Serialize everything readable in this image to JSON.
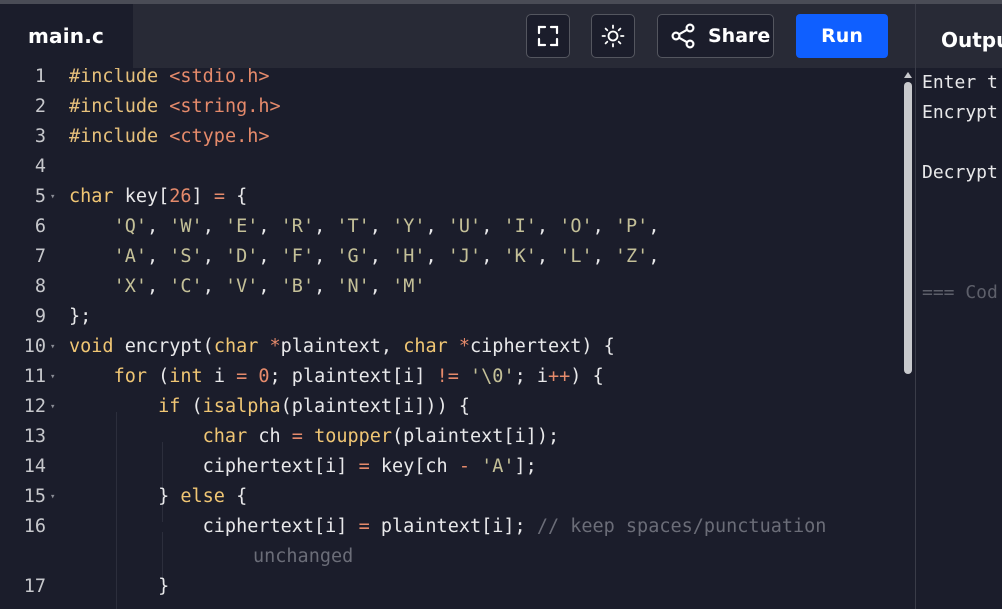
{
  "tab": {
    "title": "main.c"
  },
  "toolbar": {
    "fullscreen_icon": "fullscreen-icon",
    "theme_icon": "sun-icon",
    "share_icon": "share-icon",
    "share_label": "Share",
    "run_label": "Run",
    "run_color": "#0f5fff"
  },
  "output": {
    "title": "Output",
    "lines": [
      "Enter t",
      "Encrypt",
      "",
      "Decrypt",
      "",
      "",
      "",
      "=== Cod"
    ]
  },
  "editor": {
    "lines": [
      {
        "n": "1",
        "fold": false,
        "tokens": [
          [
            "pp",
            "#include "
          ],
          [
            "str",
            "<stdio.h>"
          ]
        ]
      },
      {
        "n": "2",
        "fold": false,
        "tokens": [
          [
            "pp",
            "#include "
          ],
          [
            "str",
            "<string.h>"
          ]
        ]
      },
      {
        "n": "3",
        "fold": false,
        "tokens": [
          [
            "pp",
            "#include "
          ],
          [
            "str",
            "<ctype.h>"
          ]
        ]
      },
      {
        "n": "4",
        "fold": false,
        "tokens": []
      },
      {
        "n": "5",
        "fold": true,
        "tokens": [
          [
            "kw",
            "char"
          ],
          [
            "txt",
            " key["
          ],
          [
            "num",
            "26"
          ],
          [
            "txt",
            "] "
          ],
          [
            "op",
            "="
          ],
          [
            "txt",
            " {"
          ]
        ]
      },
      {
        "n": "6",
        "fold": false,
        "tokens": [
          [
            "txt",
            "    "
          ],
          [
            "chr",
            "'Q'"
          ],
          [
            "txt",
            ", "
          ],
          [
            "chr",
            "'W'"
          ],
          [
            "txt",
            ", "
          ],
          [
            "chr",
            "'E'"
          ],
          [
            "txt",
            ", "
          ],
          [
            "chr",
            "'R'"
          ],
          [
            "txt",
            ", "
          ],
          [
            "chr",
            "'T'"
          ],
          [
            "txt",
            ", "
          ],
          [
            "chr",
            "'Y'"
          ],
          [
            "txt",
            ", "
          ],
          [
            "chr",
            "'U'"
          ],
          [
            "txt",
            ", "
          ],
          [
            "chr",
            "'I'"
          ],
          [
            "txt",
            ", "
          ],
          [
            "chr",
            "'O'"
          ],
          [
            "txt",
            ", "
          ],
          [
            "chr",
            "'P'"
          ],
          [
            "txt",
            ","
          ]
        ]
      },
      {
        "n": "7",
        "fold": false,
        "tokens": [
          [
            "txt",
            "    "
          ],
          [
            "chr",
            "'A'"
          ],
          [
            "txt",
            ", "
          ],
          [
            "chr",
            "'S'"
          ],
          [
            "txt",
            ", "
          ],
          [
            "chr",
            "'D'"
          ],
          [
            "txt",
            ", "
          ],
          [
            "chr",
            "'F'"
          ],
          [
            "txt",
            ", "
          ],
          [
            "chr",
            "'G'"
          ],
          [
            "txt",
            ", "
          ],
          [
            "chr",
            "'H'"
          ],
          [
            "txt",
            ", "
          ],
          [
            "chr",
            "'J'"
          ],
          [
            "txt",
            ", "
          ],
          [
            "chr",
            "'K'"
          ],
          [
            "txt",
            ", "
          ],
          [
            "chr",
            "'L'"
          ],
          [
            "txt",
            ", "
          ],
          [
            "chr",
            "'Z'"
          ],
          [
            "txt",
            ","
          ]
        ]
      },
      {
        "n": "8",
        "fold": false,
        "tokens": [
          [
            "txt",
            "    "
          ],
          [
            "chr",
            "'X'"
          ],
          [
            "txt",
            ", "
          ],
          [
            "chr",
            "'C'"
          ],
          [
            "txt",
            ", "
          ],
          [
            "chr",
            "'V'"
          ],
          [
            "txt",
            ", "
          ],
          [
            "chr",
            "'B'"
          ],
          [
            "txt",
            ", "
          ],
          [
            "chr",
            "'N'"
          ],
          [
            "txt",
            ", "
          ],
          [
            "chr",
            "'M'"
          ]
        ]
      },
      {
        "n": "9",
        "fold": false,
        "tokens": [
          [
            "txt",
            "};"
          ]
        ]
      },
      {
        "n": "10",
        "fold": true,
        "tokens": [
          [
            "kw",
            "void"
          ],
          [
            "txt",
            " encrypt("
          ],
          [
            "kw",
            "char"
          ],
          [
            "txt",
            " "
          ],
          [
            "op",
            "*"
          ],
          [
            "txt",
            "plaintext, "
          ],
          [
            "kw",
            "char"
          ],
          [
            "txt",
            " "
          ],
          [
            "op",
            "*"
          ],
          [
            "txt",
            "ciphertext) {"
          ]
        ]
      },
      {
        "n": "11",
        "fold": true,
        "tokens": [
          [
            "txt",
            "    "
          ],
          [
            "kw",
            "for"
          ],
          [
            "txt",
            " ("
          ],
          [
            "kw",
            "int"
          ],
          [
            "txt",
            " i "
          ],
          [
            "op",
            "="
          ],
          [
            "txt",
            " "
          ],
          [
            "num",
            "0"
          ],
          [
            "txt",
            "; plaintext[i] "
          ],
          [
            "op",
            "!="
          ],
          [
            "txt",
            " "
          ],
          [
            "chr",
            "'\\0'"
          ],
          [
            "txt",
            "; i"
          ],
          [
            "op",
            "++"
          ],
          [
            "txt",
            ") {"
          ]
        ]
      },
      {
        "n": "12",
        "fold": true,
        "tokens": [
          [
            "txt",
            "        "
          ],
          [
            "kw",
            "if"
          ],
          [
            "txt",
            " ("
          ],
          [
            "kw",
            "isalpha"
          ],
          [
            "txt",
            "(plaintext[i])) {"
          ]
        ]
      },
      {
        "n": "13",
        "fold": false,
        "tokens": [
          [
            "txt",
            "            "
          ],
          [
            "kw",
            "char"
          ],
          [
            "txt",
            " ch "
          ],
          [
            "op",
            "="
          ],
          [
            "txt",
            " "
          ],
          [
            "kw",
            "toupper"
          ],
          [
            "txt",
            "(plaintext[i]);"
          ]
        ]
      },
      {
        "n": "14",
        "fold": false,
        "tokens": [
          [
            "txt",
            "            ciphertext[i] "
          ],
          [
            "op",
            "="
          ],
          [
            "txt",
            " key[ch "
          ],
          [
            "op",
            "-"
          ],
          [
            "txt",
            " "
          ],
          [
            "chr",
            "'A'"
          ],
          [
            "txt",
            "];"
          ]
        ]
      },
      {
        "n": "15",
        "fold": true,
        "tokens": [
          [
            "txt",
            "        } "
          ],
          [
            "kw",
            "else"
          ],
          [
            "txt",
            " {"
          ]
        ]
      },
      {
        "n": "16",
        "fold": false,
        "tokens": [
          [
            "txt",
            "            ciphertext[i] "
          ],
          [
            "op",
            "="
          ],
          [
            "txt",
            " plaintext[i]; "
          ],
          [
            "cmt",
            "// keep spaces/punctuation"
          ]
        ],
        "wrap": "unchanged"
      },
      {
        "n": "17",
        "fold": false,
        "tokens": [
          [
            "txt",
            "        }"
          ]
        ]
      }
    ]
  }
}
